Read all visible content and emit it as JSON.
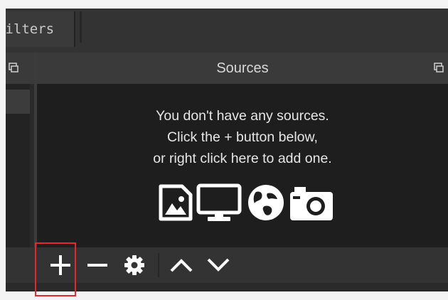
{
  "filters_tab": {
    "label": "Filters"
  },
  "sources_panel": {
    "title": "Sources",
    "empty_message": [
      "You don't have any sources.",
      "Click the + button below,",
      "or right click here to add one."
    ],
    "source_type_icons": [
      "image-source-icon",
      "display-capture-icon",
      "browser-source-icon",
      "camera-source-icon"
    ]
  },
  "toolbar": {
    "buttons": [
      "add-icon",
      "remove-icon",
      "properties-icon",
      "move-up-icon",
      "move-down-icon"
    ]
  },
  "colors": {
    "highlight": "#e8262b",
    "panel_background": "#1e1e1e",
    "title_bar": "#3a3a3a",
    "text": "#e6e6e6"
  }
}
